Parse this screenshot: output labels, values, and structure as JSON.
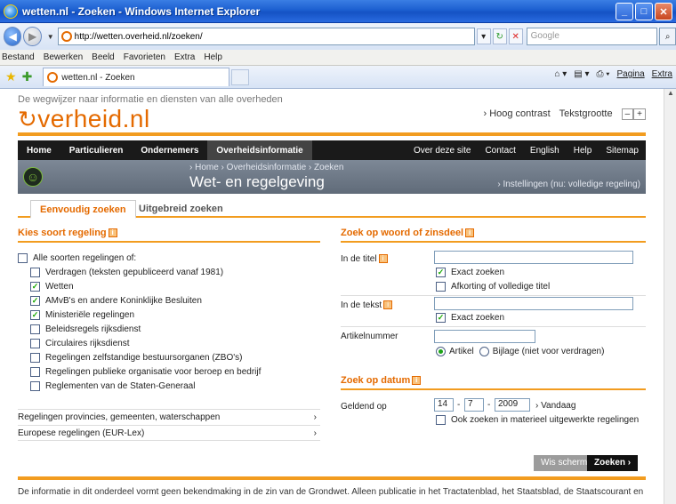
{
  "window": {
    "title": "wetten.nl - Zoeken - Windows Internet Explorer"
  },
  "address": {
    "url": "http://wetten.overheid.nl/zoeken/",
    "search_placeholder": "Google"
  },
  "menu": [
    "Bestand",
    "Bewerken",
    "Beeld",
    "Favorieten",
    "Extra",
    "Help"
  ],
  "browser_tab": {
    "label": "wetten.nl - Zoeken"
  },
  "command_bar": {
    "page": "Pagina",
    "tools": "Extra"
  },
  "header": {
    "tagline": "De wegwijzer naar informatie en diensten van alle overheden",
    "logo": "verheid.nl",
    "high_contrast": "› Hoog contrast",
    "text_size": "Tekstgrootte",
    "minus": "–",
    "plus": "+"
  },
  "nav": {
    "left": [
      "Home",
      "Particulieren",
      "Ondernemers",
      "Overheidsinformatie"
    ],
    "right": [
      "Over deze site",
      "Contact",
      "English",
      "Help",
      "Sitemap"
    ]
  },
  "banner": {
    "breadcrumb": "› Home  › Overheidsinformatie  › Zoeken",
    "title": "Wet- en regelgeving",
    "settings": "› Instellingen (nu: volledige regeling)"
  },
  "tabs": {
    "simple": "Eenvoudig zoeken",
    "advanced": "Uitgebreid zoeken"
  },
  "left": {
    "heading": "Kies soort regeling",
    "all": "Alle soorten regelingen of:",
    "options": [
      {
        "label": "Verdragen (teksten gepubliceerd vanaf 1981)",
        "checked": false
      },
      {
        "label": "Wetten",
        "checked": true
      },
      {
        "label": "AMvB's en andere Koninklijke Besluiten",
        "checked": true
      },
      {
        "label": "Ministeriële regelingen",
        "checked": true
      },
      {
        "label": "Beleidsregels rijksdienst",
        "checked": false
      },
      {
        "label": "Circulaires rijksdienst",
        "checked": false
      },
      {
        "label": "Regelingen zelfstandige bestuursorganen (ZBO's)",
        "checked": false
      },
      {
        "label": "Regelingen publieke organisatie voor beroep en bedrijf",
        "checked": false
      },
      {
        "label": "Reglementen van de Staten-Generaal",
        "checked": false
      }
    ],
    "link1": "Regelingen provincies, gemeenten, waterschappen",
    "link2": "Europese regelingen (EUR-Lex)",
    "chev": "›"
  },
  "right": {
    "heading_word": "Zoek op woord of zinsdeel",
    "title_label": "In de titel",
    "exact1": "Exact zoeken",
    "abbrev": "Afkorting of volledige titel",
    "text_label": "In de tekst",
    "exact2": "Exact zoeken",
    "article_label": "Artikelnummer",
    "radio_article": "Artikel",
    "radio_annex": "Bijlage (niet voor verdragen)",
    "heading_date": "Zoek op datum",
    "valid_label": "Geldend op",
    "day": "14",
    "month": "7",
    "year": "2009",
    "dash": "-",
    "today": "› Vandaag",
    "material": "Ook zoeken in materieel uitgewerkte regelingen",
    "clear": "Wis scherm",
    "search": "Zoeken ›"
  },
  "footer": {
    "text": "De informatie in dit onderdeel vormt geen bekendmaking in de zin van de Grondwet. Alleen publicatie in het Tractatenblad, het Staatsblad, de Staatscourant en"
  }
}
